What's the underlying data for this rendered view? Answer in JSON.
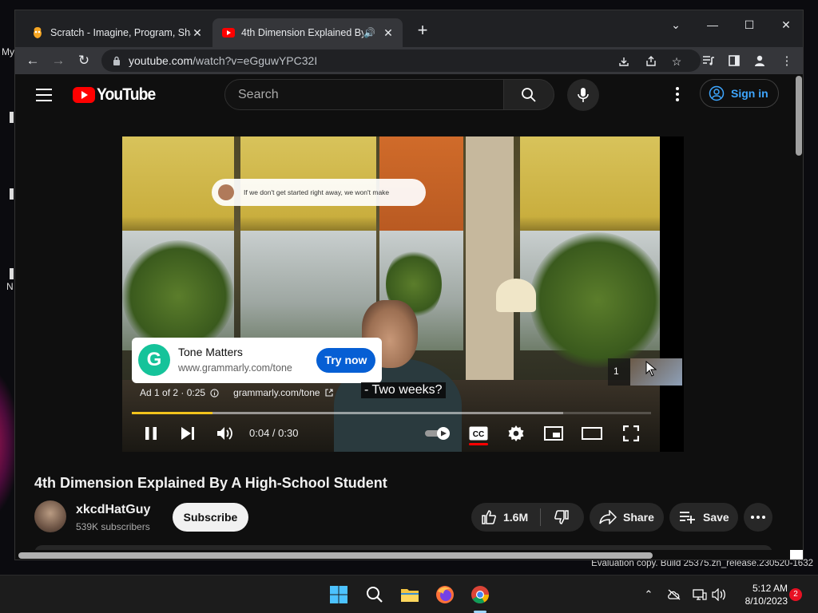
{
  "desktop": {
    "partial_labels": [
      "My",
      "N"
    ],
    "watermark": "Evaluation copy. Build 25375.zn_release.230520-1632"
  },
  "browser": {
    "tabs": [
      {
        "title": "Scratch - Imagine, Program, Shar",
        "icon": "scratch-favicon",
        "active": false
      },
      {
        "title": "4th Dimension Explained By",
        "icon": "youtube-favicon",
        "active": true,
        "audio": true
      }
    ],
    "url_host": "youtube.com",
    "url_path": "/watch?v=eGguwYPC32I"
  },
  "youtube": {
    "logo_text": "YouTube",
    "search_placeholder": "Search",
    "sign_in_label": "Sign in",
    "video": {
      "overlay_bubble_text": "If we don't get started right away, we won't make",
      "ad": {
        "advertiser": "Tone Matters",
        "domain": "www.grammarly.com/tone",
        "cta": "Try now",
        "logo_letter": "G",
        "meta": "Ad 1 of 2 · 0:25",
        "link": "grammarly.com/tone",
        "queue_count": "1"
      },
      "caption": "- Two weeks?",
      "time": "0:04 / 0:30",
      "played_fraction": 0.155,
      "loaded_fraction": 0.83
    },
    "title": "4th Dimension Explained By A High-School Student",
    "channel": {
      "name": "xkcdHatGuy",
      "subscribers": "539K subscribers",
      "subscribe_label": "Subscribe"
    },
    "actions": {
      "likes": "1.6M",
      "share": "Share",
      "save": "Save"
    }
  },
  "taskbar": {
    "time": "5:12 AM",
    "date": "8/10/2023",
    "notification_count": "2"
  },
  "colors": {
    "youtube_red": "#ff0000",
    "ad_blue": "#065fd4",
    "ad_progress": "#f2c31c",
    "grammarly_green": "#15c39a",
    "link_blue": "#3ea6ff"
  }
}
